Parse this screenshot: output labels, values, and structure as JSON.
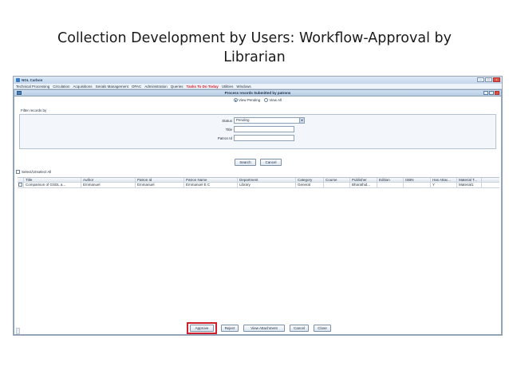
{
  "slide": {
    "title_line1": "Collection Development by Users: Workflow-Approval by",
    "title_line2": "Librarian"
  },
  "app": {
    "title": "NGL Carbon",
    "title_extra": "",
    "menu": [
      {
        "label": "Technical Processing"
      },
      {
        "label": "Circulation"
      },
      {
        "label": "Acquisitions"
      },
      {
        "label": "Serials Management"
      },
      {
        "label": "OPAC"
      },
      {
        "label": "Administration"
      },
      {
        "label": "Queries"
      },
      {
        "label": "Tasks To Do Today"
      },
      {
        "label": "Utilities"
      },
      {
        "label": "Windows"
      }
    ],
    "active_menu": "Tasks To Do Today"
  },
  "dialog": {
    "title": "Process records Submitted by patrons",
    "radio_view_pending": "View Pending",
    "radio_view_all": "View All",
    "filter_label": "Filter records by",
    "status_label": "Status",
    "status_value": "Pending",
    "title_label": "Title",
    "title_value": "",
    "patron_id_label": "Patron Id",
    "patron_id_value": "",
    "search_button": "Search",
    "cancel_filter_button": "Cancel",
    "select_all_label": "Select/Unselect All",
    "columns": [
      "Title",
      "Author",
      "Patron Id",
      "Patron Name",
      "Department",
      "Category",
      "Course",
      "Publisher",
      "Edition",
      "ISBN",
      "Has Attac...",
      "Material T..."
    ],
    "rows": [
      [
        "Comparison of GSDL a...",
        "Emmanuel",
        "Emmanuel",
        "Emmanuel E C",
        "Library",
        "General",
        "",
        "Bharathid...",
        "",
        "",
        "Y",
        "Material1"
      ]
    ],
    "buttons": {
      "approve": "Approve",
      "reject": "Reject",
      "view_attachment": "View Attachment",
      "cancel": "Cancel",
      "close": "Close"
    }
  },
  "colors": {
    "highlight": "#d0202e",
    "active_menu": "#d8202a"
  }
}
